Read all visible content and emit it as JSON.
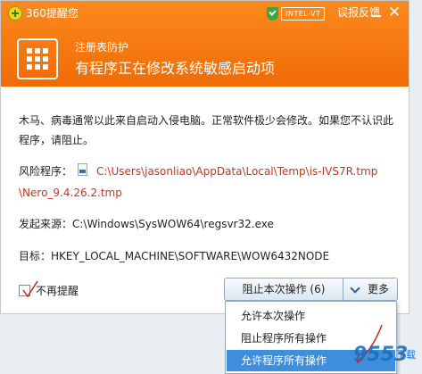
{
  "titlebar": {
    "app_title": "360提醒您",
    "intel_tag": "INTEL-VT",
    "feedback": "误报反馈",
    "close_glyph": "✕"
  },
  "header": {
    "protect_label": "注册表防护",
    "warning_title": "有程序正在修改系统敏感启动项"
  },
  "body": {
    "description": "木马、病毒通常以此来自启动入侵电脑。正常软件极少会修改。如果您不认识此程序，请阻止。",
    "risk_label": "风险程序：",
    "risk_path_line1": "C:\\Users\\jasonliao\\AppData\\Local\\Temp\\is-IVS7R.tmp",
    "risk_path_line2": "\\Nero_9.4.26.2.tmp",
    "source_label": "发起来源：",
    "source_value": "C:\\Windows\\SysWOW64\\regsvr32.exe",
    "target_label": "目标：",
    "target_value": "HKEY_LOCAL_MACHINE\\SOFTWARE\\WOW6432NODE"
  },
  "footer": {
    "no_remind": "不再提醒",
    "block_button": "阻止本次操作 (6)",
    "more_button": "更多"
  },
  "menu": {
    "items": [
      {
        "label": "允许本次操作"
      },
      {
        "label": "阻止程序所有操作"
      },
      {
        "label": "允许程序所有操作"
      }
    ]
  },
  "watermark": {
    "text": "9553",
    "sub": "下载"
  },
  "colors": {
    "header_orange": "#f27508",
    "path_red": "#c8361b",
    "menu_selected": "#3e8ede"
  }
}
